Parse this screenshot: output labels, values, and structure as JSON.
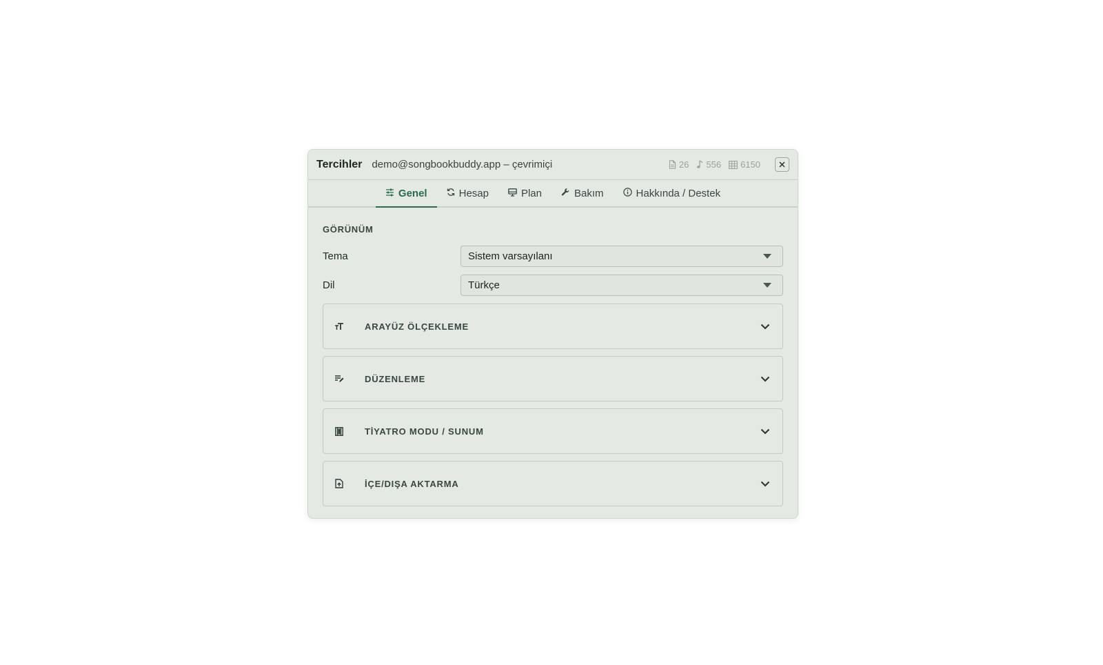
{
  "header": {
    "title": "Tercihler",
    "subtitle": "demo@songbookbuddy.app – çevrimiçi",
    "stats": {
      "documents": "26",
      "songs": "556",
      "rows": "6150"
    },
    "close_label": "×"
  },
  "tabs": [
    {
      "label": "Genel",
      "icon": "sliders-icon",
      "active": true
    },
    {
      "label": "Hesap",
      "icon": "sync-icon",
      "active": false
    },
    {
      "label": "Plan",
      "icon": "monitor-icon",
      "active": false
    },
    {
      "label": "Bakım",
      "icon": "wrench-icon",
      "active": false
    },
    {
      "label": "Hakkında / Destek",
      "icon": "info-icon",
      "active": false
    }
  ],
  "appearance": {
    "section_title": "GÖRÜNÜM",
    "theme": {
      "label": "Tema",
      "value": "Sistem varsayılanı"
    },
    "language": {
      "label": "Dil",
      "value": "Türkçe"
    }
  },
  "accordions": [
    {
      "title": "ARAYÜZ ÖLÇEKLEME",
      "icon": "text-size-icon"
    },
    {
      "title": "DÜZENLEME",
      "icon": "edit-list-icon"
    },
    {
      "title": "TİYATRO MODU / SUNUM",
      "icon": "theater-icon"
    },
    {
      "title": "İÇE/DIŞA AKTARMA",
      "icon": "file-import-icon"
    }
  ],
  "colors": {
    "accent": "#2a6b4c",
    "background": "#e4e9e3",
    "border": "#c3cbc4"
  }
}
